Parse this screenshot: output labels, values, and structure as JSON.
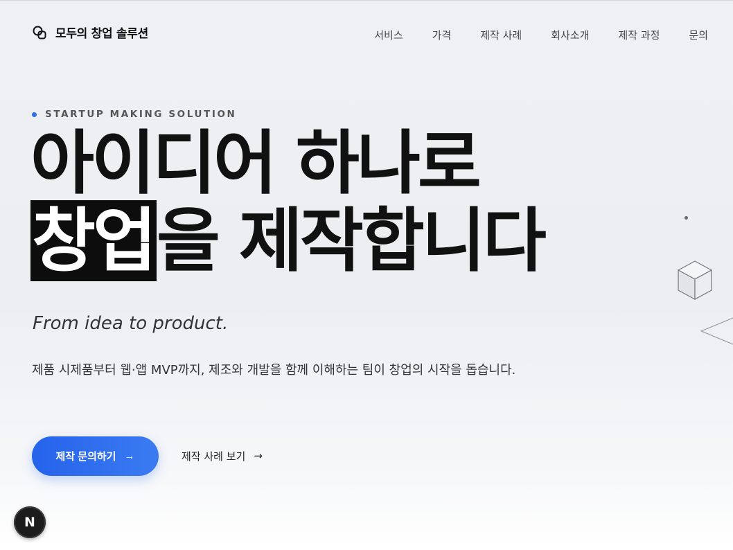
{
  "header": {
    "logo_text": "모두의 창업 솔루션",
    "nav": [
      {
        "label": "서비스"
      },
      {
        "label": "가격"
      },
      {
        "label": "제작 사례"
      },
      {
        "label": "회사소개"
      },
      {
        "label": "제작 과정"
      },
      {
        "label": "문의"
      }
    ]
  },
  "hero": {
    "eyebrow": "STARTUP MAKING SOLUTION",
    "headline_line1": "아이디어 하나로",
    "headline_highlight": "창업",
    "headline_line2_rest": "을 제작합니다",
    "tagline": "From idea to product.",
    "description": "제품 시제품부터 웹·앱 MVP까지, 제조와 개발을 함께 이해하는 팀이 창업의 시작을 돕습니다.",
    "primary_button": "제작 문의하기",
    "secondary_button": "제작 사례 보기",
    "arrow_glyph": "→"
  },
  "badge": {
    "letter": "N"
  },
  "colors": {
    "accent": "#2563eb",
    "eyebrow_dot": "#2f6fe8",
    "highlight_bg": "#0d0d0d"
  },
  "icons": [
    "logo-icon",
    "arrow-right-icon",
    "cube-icon",
    "diamond-icon",
    "next-badge-icon"
  ]
}
